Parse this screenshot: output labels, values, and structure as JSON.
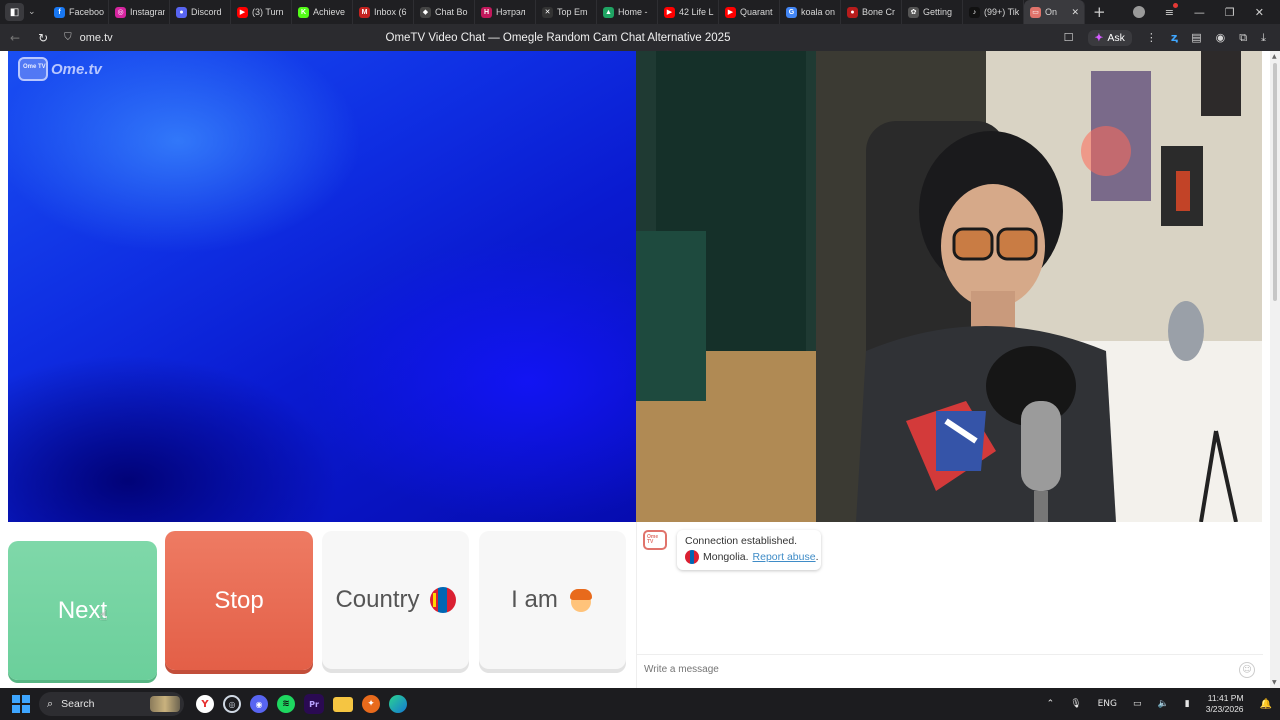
{
  "browser": {
    "tabs": [
      {
        "label": "Facebook",
        "icon": "facebook-icon",
        "color": "#1877f2",
        "glyph": "f"
      },
      {
        "label": "Instagram",
        "icon": "instagram-icon",
        "color": "#d6249f",
        "glyph": "◎"
      },
      {
        "label": "Discord",
        "icon": "discord-icon",
        "color": "#5865f2",
        "glyph": "●"
      },
      {
        "label": "(3) Turn",
        "icon": "youtube-icon",
        "color": "#ff0000",
        "glyph": "▶"
      },
      {
        "label": "Achieve",
        "icon": "kick-icon",
        "color": "#53fc18",
        "glyph": "K"
      },
      {
        "label": "Inbox (6",
        "icon": "gmail-icon",
        "color": "#c5221f",
        "glyph": "M"
      },
      {
        "label": "Chat Bo",
        "icon": "chatbot-icon",
        "color": "#444444",
        "glyph": "◆"
      },
      {
        "label": "Нэтрэл",
        "icon": "bookmark-icon",
        "color": "#c2185b",
        "glyph": "H"
      },
      {
        "label": "Top Em",
        "icon": "x-icon",
        "color": "#333333",
        "glyph": "✕"
      },
      {
        "label": "Home -",
        "icon": "drive-icon",
        "color": "#1fa463",
        "glyph": "▲"
      },
      {
        "label": "42 Life L",
        "icon": "youtube-icon",
        "color": "#ff0000",
        "glyph": "▶"
      },
      {
        "label": "Quarant",
        "icon": "youtube-icon",
        "color": "#ff0000",
        "glyph": "▶"
      },
      {
        "label": "koala on",
        "icon": "google-icon",
        "color": "#4285f4",
        "glyph": "G"
      },
      {
        "label": "Bone Cr",
        "icon": "record-icon",
        "color": "#b71c1c",
        "glyph": "●"
      },
      {
        "label": "Getting",
        "icon": "chatgpt-icon",
        "color": "#555555",
        "glyph": "✿"
      },
      {
        "label": "(99+) Tik",
        "icon": "tiktok-icon",
        "color": "#111111",
        "glyph": "♪"
      },
      {
        "label": "On",
        "icon": "ometv-icon",
        "color": "#e0736b",
        "glyph": "▭",
        "active": true
      }
    ],
    "url": "ome.tv",
    "title": "OmeTV Video Chat — Omegle Random Cam Chat Alternative 2025",
    "ask_label": "Ask"
  },
  "page": {
    "logo_text": "Ome.tv",
    "logo_badge": "Ome TV",
    "buttons": {
      "next": "Next",
      "stop": "Stop",
      "country": "Country",
      "iam": "I am"
    },
    "chat": {
      "status": "Connection established.",
      "country": "Mongolia.",
      "report": "Report abuse",
      "report_suffix": ".",
      "placeholder": "Write a message"
    }
  },
  "taskbar": {
    "search_label": "Search",
    "language": "ENG",
    "time": "11:41 PM",
    "date": "3/23/2026"
  },
  "colors": {
    "next": "#6fd19e",
    "stop": "#e5654d",
    "link": "#3f8cc7",
    "video_left": "#0f2fe3"
  }
}
